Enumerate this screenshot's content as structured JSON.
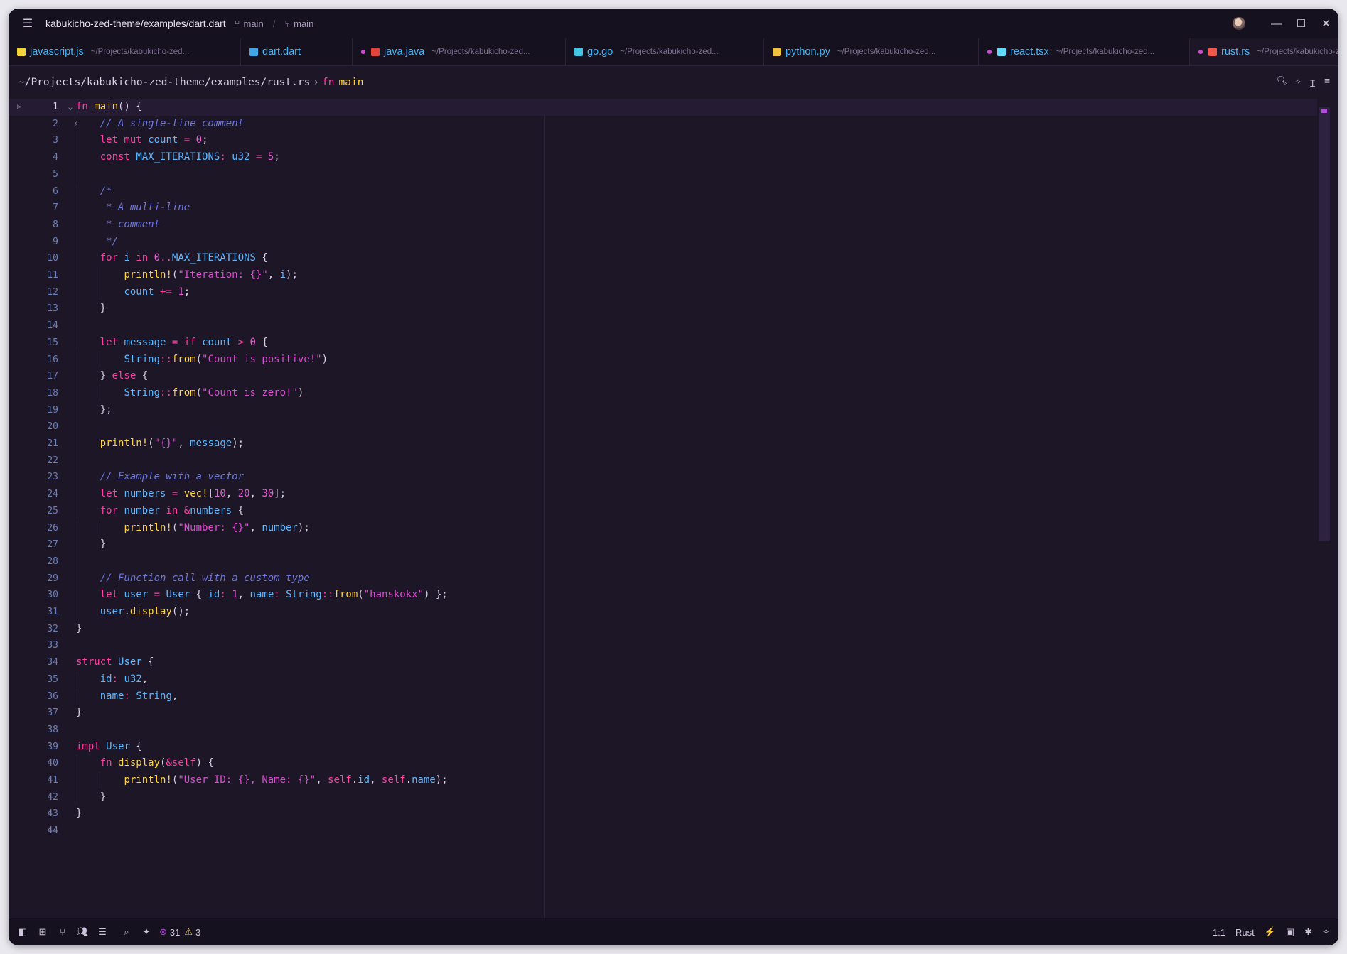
{
  "titlebar": {
    "project_path": "kabukicho-zed-theme/examples/dart.dart",
    "branch1": "main",
    "branch2": "main"
  },
  "tabs": [
    {
      "name": "javascript.js",
      "path": "~/Projects/kabukicho-zed...",
      "icon": "javascript-icon",
      "dot": false
    },
    {
      "name": "dart.dart",
      "path": "",
      "icon": "dart-icon",
      "dot": false
    },
    {
      "name": "java.java",
      "path": "~/Projects/kabukicho-zed...",
      "icon": "java-icon",
      "dot": true
    },
    {
      "name": "go.go",
      "path": "~/Projects/kabukicho-zed...",
      "icon": "go-icon",
      "dot": false
    },
    {
      "name": "python.py",
      "path": "~/Projects/kabukicho-zed...",
      "icon": "python-icon",
      "dot": false
    },
    {
      "name": "react.tsx",
      "path": "~/Projects/kabukicho-zed...",
      "icon": "react-icon",
      "dot": true
    },
    {
      "name": "rust.rs",
      "path": "~/Projects/kabukicho-zed...",
      "icon": "rust-icon",
      "dot": true
    }
  ],
  "breadcrumb": {
    "path": "~/Projects/kabukicho-zed-theme/examples/rust.rs",
    "separator": "›",
    "symbol_kw": "fn",
    "symbol_name": "main"
  },
  "editor": {
    "current_line": 1,
    "line_count": 44
  },
  "statusbar": {
    "errors": "31",
    "warnings": "3",
    "cursor": "1:1",
    "language": "Rust"
  },
  "colors": {
    "background": "#1d1627",
    "keyword": "#ff3fa4",
    "function": "#ffd43b",
    "variable": "#5ab8ff",
    "string": "#d94cd0",
    "comment": "#6e77d8",
    "accent": "#b04cd9"
  }
}
